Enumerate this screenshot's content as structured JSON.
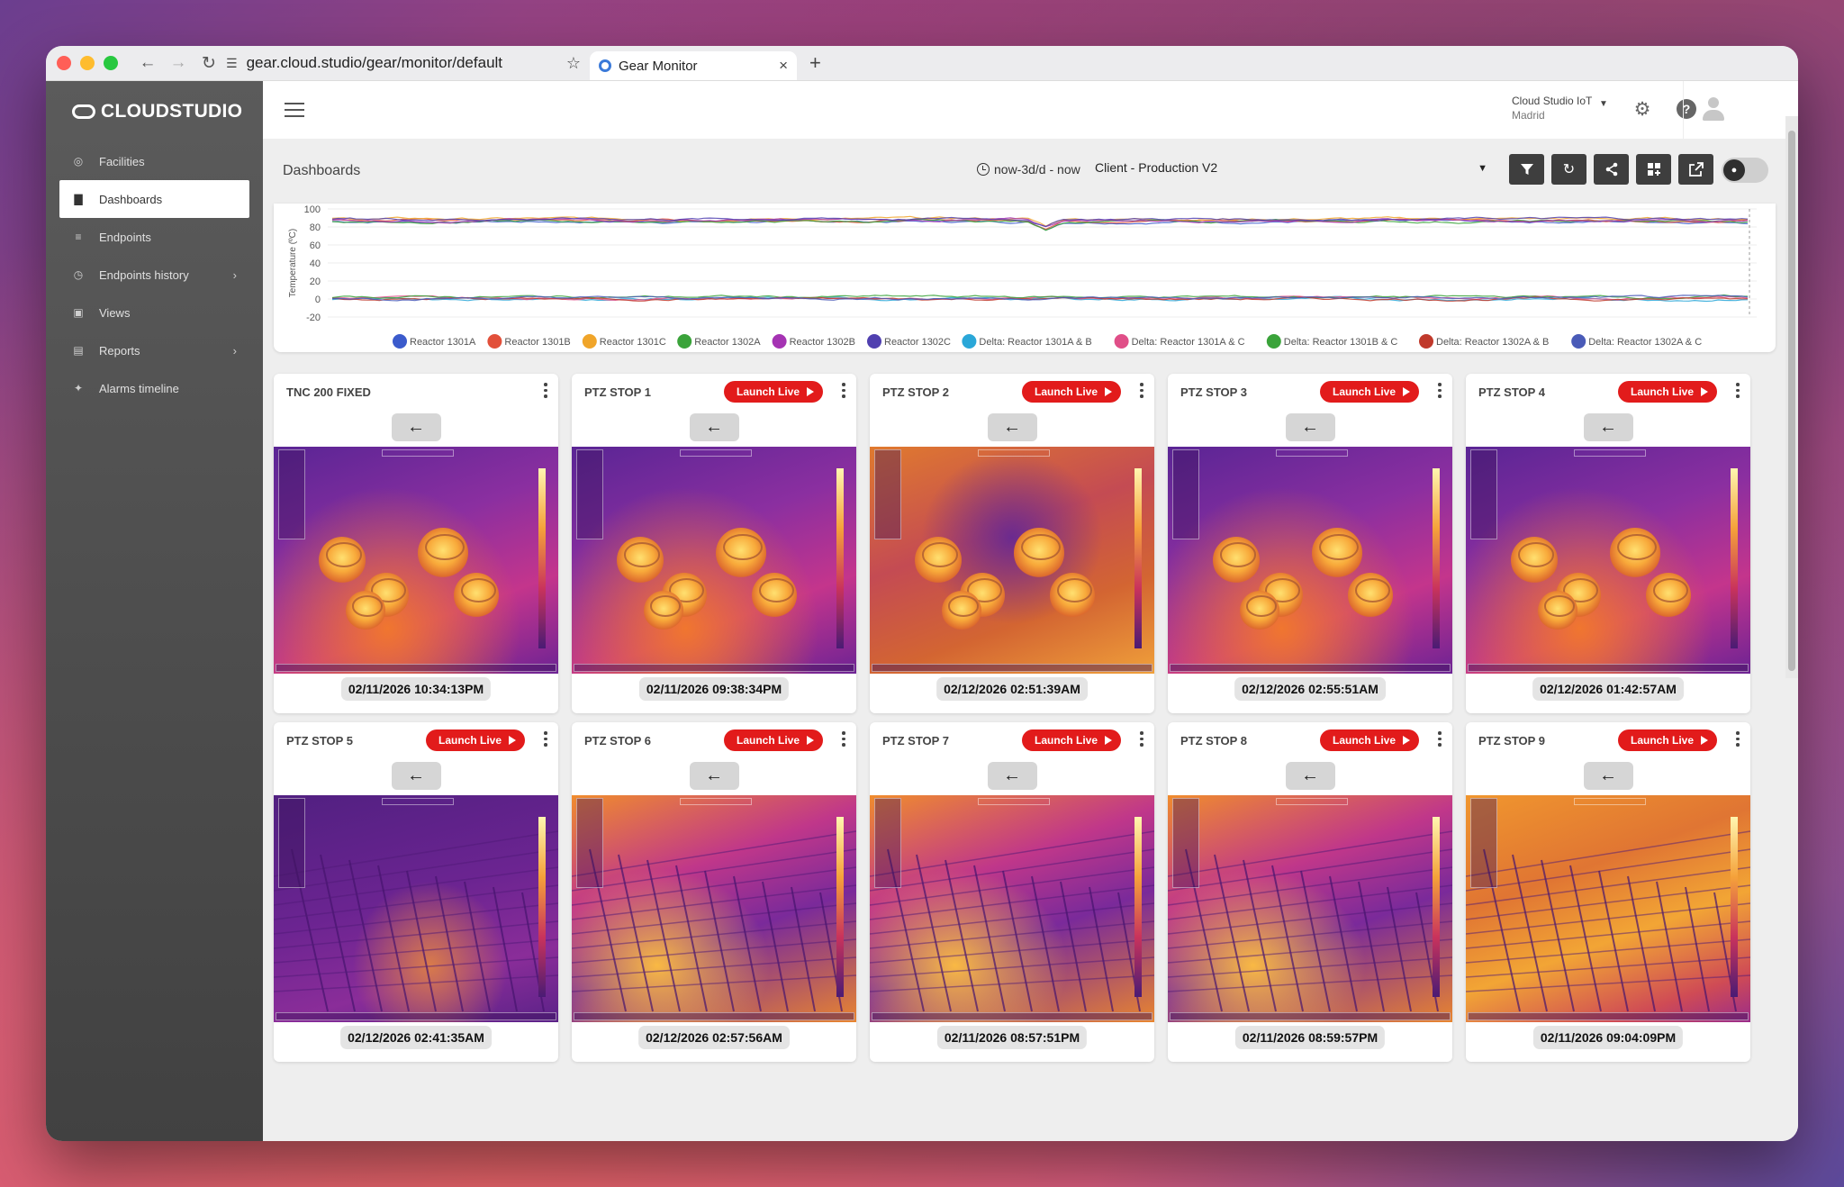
{
  "browser": {
    "url": "gear.cloud.studio/gear/monitor/default",
    "tab_title": "Gear Monitor"
  },
  "sidebar": {
    "brand": "CLOUDSTUDIO",
    "items": [
      {
        "label": "Facilities",
        "icon": "globe-icon"
      },
      {
        "label": "Dashboards",
        "icon": "chart-icon"
      },
      {
        "label": "Endpoints",
        "icon": "list-icon"
      },
      {
        "label": "Endpoints history",
        "icon": "clock-icon"
      },
      {
        "label": "Views",
        "icon": "image-icon"
      },
      {
        "label": "Reports",
        "icon": "file-icon"
      },
      {
        "label": "Alarms timeline",
        "icon": "sitemap-icon"
      }
    ]
  },
  "header": {
    "user_name": "Cloud Studio IoT",
    "user_location": "Madrid"
  },
  "dashboard": {
    "title": "Dashboards",
    "time_range": "now-3d/d - now",
    "selected": "Client - Production V2"
  },
  "chart_data": {
    "type": "line",
    "ylabel": "Temperature (ºC)",
    "ylim": [
      -20,
      100
    ],
    "yticks": [
      "100",
      "80",
      "60",
      "40",
      "20",
      "0",
      "-20"
    ],
    "series": [
      {
        "name": "Reactor 1301A",
        "color": "#3b5bcc",
        "band": "upper"
      },
      {
        "name": "Reactor 1301B",
        "color": "#e2503a",
        "band": "upper"
      },
      {
        "name": "Reactor 1301C",
        "color": "#f0a52a",
        "band": "upper"
      },
      {
        "name": "Reactor 1302A",
        "color": "#3aa33a",
        "band": "upper"
      },
      {
        "name": "Reactor 1302B",
        "color": "#a533b3",
        "band": "upper"
      },
      {
        "name": "Reactor 1302C",
        "color": "#5040b0",
        "band": "upper"
      },
      {
        "name": "Delta: Reactor 1301A & B",
        "color": "#2aa7d8",
        "band": "lower"
      },
      {
        "name": "Delta: Reactor 1301A & C",
        "color": "#e04f88",
        "band": "lower"
      },
      {
        "name": "Delta: Reactor 1301B & C",
        "color": "#3aa33a",
        "band": "lower"
      },
      {
        "name": "Delta: Reactor 1302A & B",
        "color": "#c0392b",
        "band": "lower"
      },
      {
        "name": "Delta: Reactor 1302A & C",
        "color": "#4a5bb8",
        "band": "lower"
      }
    ]
  },
  "cameras": [
    {
      "title": "TNC 200 FIXED",
      "launch": "",
      "timestamp": "02/11/2026 10:34:13PM",
      "scene": "reactors"
    },
    {
      "title": "PTZ STOP 1",
      "launch": "Launch Live",
      "timestamp": "02/11/2026 09:38:34PM",
      "scene": "reactors"
    },
    {
      "title": "PTZ STOP 2",
      "launch": "Launch Live",
      "timestamp": "02/12/2026 02:51:39AM",
      "scene": "reactors-cool"
    },
    {
      "title": "PTZ STOP 3",
      "launch": "Launch Live",
      "timestamp": "02/12/2026 02:55:51AM",
      "scene": "reactors"
    },
    {
      "title": "PTZ STOP 4",
      "launch": "Launch Live",
      "timestamp": "02/12/2026 01:42:57AM",
      "scene": "reactors"
    },
    {
      "title": "PTZ STOP 5",
      "launch": "Launch Live",
      "timestamp": "02/12/2026 02:41:35AM",
      "scene": "yard-cool"
    },
    {
      "title": "PTZ STOP 6",
      "launch": "Launch Live",
      "timestamp": "02/12/2026 02:57:56AM",
      "scene": "yard"
    },
    {
      "title": "PTZ STOP 7",
      "launch": "Launch Live",
      "timestamp": "02/11/2026 08:57:51PM",
      "scene": "yard"
    },
    {
      "title": "PTZ STOP 8",
      "launch": "Launch Live",
      "timestamp": "02/11/2026 08:59:57PM",
      "scene": "yard"
    },
    {
      "title": "PTZ STOP 9",
      "launch": "Launch Live",
      "timestamp": "02/11/2026 09:04:09PM",
      "scene": "yard-hot"
    }
  ]
}
